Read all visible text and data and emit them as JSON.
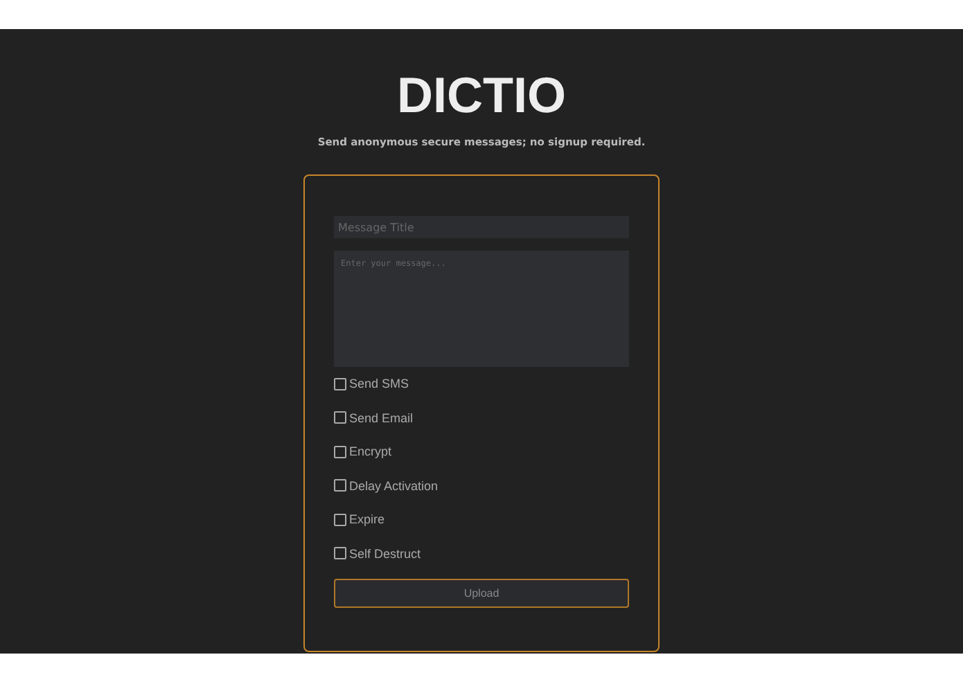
{
  "header": {
    "title": "DICTIO",
    "tagline": "Send anonymous secure messages; no signup required."
  },
  "form": {
    "title_field": {
      "placeholder": "Message Title"
    },
    "message_field": {
      "placeholder": "Enter your message..."
    },
    "options": [
      {
        "label": "Send SMS",
        "checked": false
      },
      {
        "label": "Send Email",
        "checked": false
      },
      {
        "label": "Encrypt",
        "checked": false
      },
      {
        "label": "Delay Activation",
        "checked": false
      },
      {
        "label": "Expire",
        "checked": false
      },
      {
        "label": "Self Destruct",
        "checked": false
      }
    ],
    "submit_button": "Upload"
  }
}
